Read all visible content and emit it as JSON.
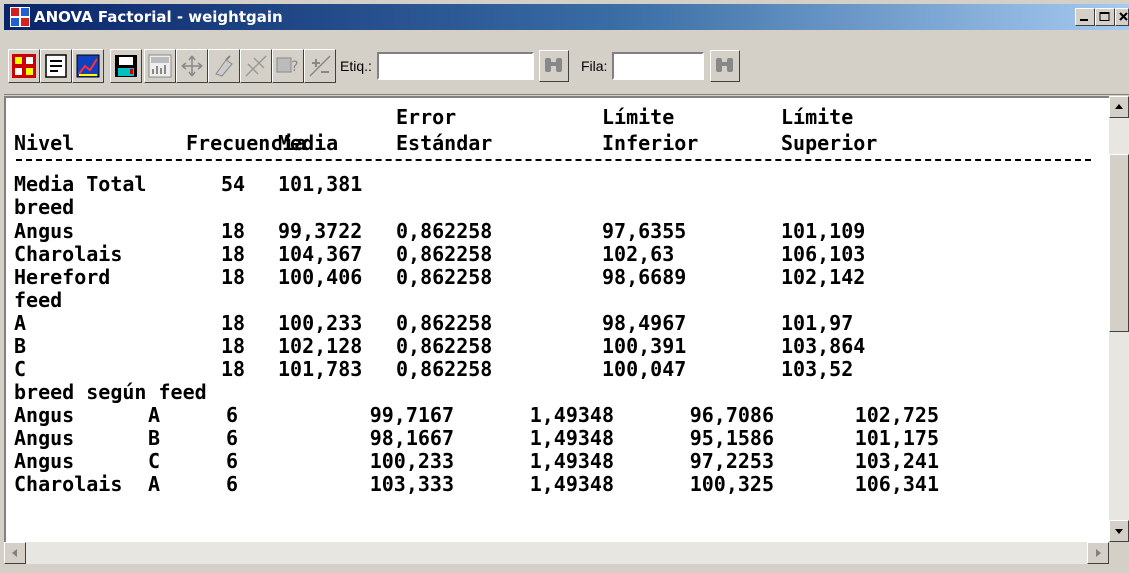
{
  "window": {
    "title": "ANOVA Factorial - weightgain"
  },
  "toolbar": {
    "buttons": [
      "input-dialog-icon",
      "analysis-options-icon",
      "graphics-options-icon",
      "save-results-icon",
      "table-icon",
      "scatter-icon",
      "brush-icon",
      "smooth-icon",
      "query-icon",
      "plus-minus-icon"
    ],
    "etiq_label": "Etiq.:",
    "etiq_value": "",
    "fila_label": "Fila:",
    "fila_value": ""
  },
  "table": {
    "headers": {
      "nivel": "Nivel",
      "frecuencia": "Frecuencia",
      "media": "Media",
      "error_line1": "Error",
      "error_line2": "Estándar",
      "inferior_line1": "Límite",
      "inferior_line2": "Inferior",
      "superior_line1": "Límite",
      "superior_line2": "Superior"
    },
    "total": {
      "label": "Media Total",
      "frecuencia": "54",
      "media": "101,381"
    },
    "groups": [
      {
        "name": "breed",
        "rows": [
          {
            "label": "Angus",
            "frecuencia": "18",
            "media": "99,3722",
            "error": "0,862258",
            "inferior": "97,6355",
            "superior": "101,109"
          },
          {
            "label": "Charolais",
            "frecuencia": "18",
            "media": "104,367",
            "error": "0,862258",
            "inferior": "102,63",
            "superior": "106,103"
          },
          {
            "label": "Hereford",
            "frecuencia": "18",
            "media": "100,406",
            "error": "0,862258",
            "inferior": "98,6689",
            "superior": "102,142"
          }
        ]
      },
      {
        "name": "feed",
        "rows": [
          {
            "label": "A",
            "frecuencia": "18",
            "media": "100,233",
            "error": "0,862258",
            "inferior": "98,4967",
            "superior": "101,97"
          },
          {
            "label": "B",
            "frecuencia": "18",
            "media": "102,128",
            "error": "0,862258",
            "inferior": "100,391",
            "superior": "103,864"
          },
          {
            "label": "C",
            "frecuencia": "18",
            "media": "101,783",
            "error": "0,862258",
            "inferior": "100,047",
            "superior": "103,52"
          }
        ]
      }
    ],
    "interaction": {
      "name": "breed según feed",
      "rows": [
        {
          "breed": "Angus",
          "feed": "A",
          "frecuencia": "6",
          "media": "99,7167",
          "error": "1,49348",
          "inferior": "96,7086",
          "superior": "102,725"
        },
        {
          "breed": "Angus",
          "feed": "B",
          "frecuencia": "6",
          "media": "98,1667",
          "error": "1,49348",
          "inferior": "95,1586",
          "superior": "101,175"
        },
        {
          "breed": "Angus",
          "feed": "C",
          "frecuencia": "6",
          "media": "100,233",
          "error": "1,49348",
          "inferior": "97,2253",
          "superior": "103,241"
        },
        {
          "breed": "Charolais",
          "feed": "A",
          "frecuencia": "6",
          "media": "103,333",
          "error": "1,49348",
          "inferior": "100,325",
          "superior": "106,341"
        }
      ]
    }
  }
}
